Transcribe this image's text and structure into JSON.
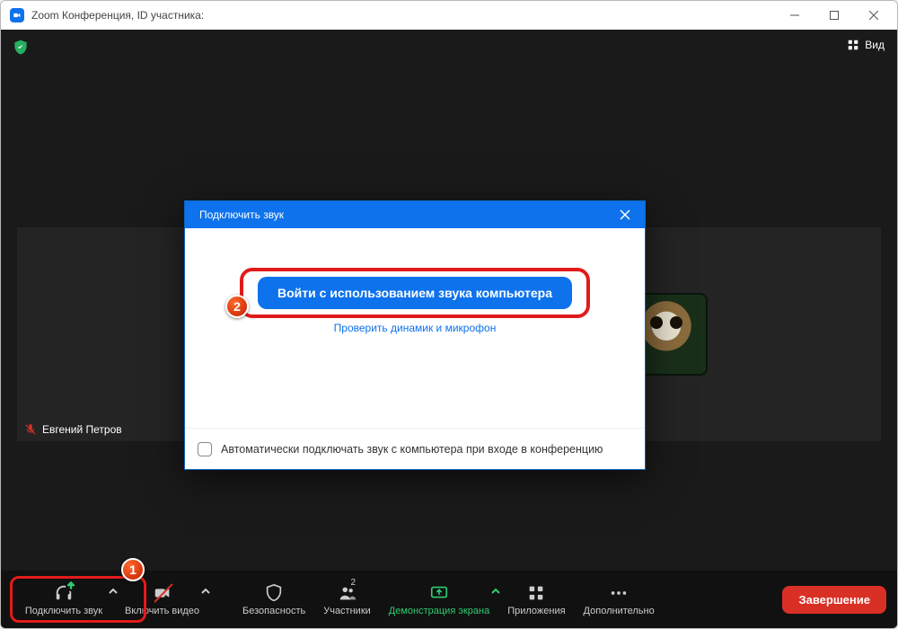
{
  "window": {
    "title": "Zoom Конференция, ID участника:"
  },
  "topbar": {
    "view_label": "Вид"
  },
  "participants": {
    "left": {
      "name": "Евгений Петров"
    }
  },
  "toolbar": {
    "audio": "Подключить звук",
    "video": "Включить видео",
    "security": "Безопасность",
    "participants": "Участники",
    "participants_count": "2",
    "share": "Демонстрация экрана",
    "apps": "Приложения",
    "more": "Дополнительно",
    "end": "Завершение"
  },
  "dialog": {
    "title": "Подключить звук",
    "primary": "Войти с использованием звука компьютера",
    "test_link": "Проверить динамик и микрофон",
    "auto_checkbox": "Автоматически подключать звук с компьютера при входе в конференцию"
  },
  "annotations": {
    "step1": "1",
    "step2": "2"
  }
}
